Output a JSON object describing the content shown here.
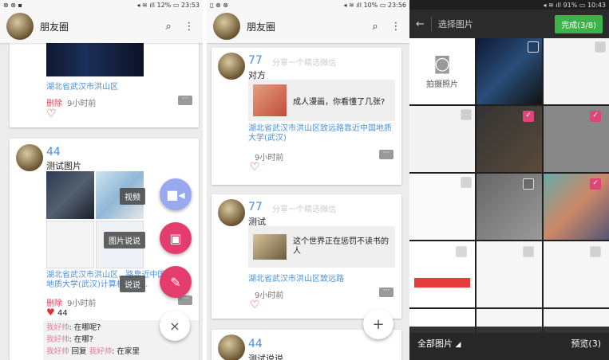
{
  "screen1": {
    "status_time": "23:53",
    "status_battery": "12%",
    "title": "朋友圈",
    "post1": {
      "location": "湖北省武汉市洪山区",
      "delete": "删除",
      "time": "9小时前"
    },
    "post2": {
      "num": "44",
      "text": "测试图片",
      "location": "湖北省武汉市洪山区...路靠近中国地质大学(武汉)计算机实验...",
      "delete": "删除",
      "time": "9小时前",
      "likes": "44",
      "comments": [
        {
          "user": "我好帅",
          "sep": ": ",
          "text": "在哪呢?"
        },
        {
          "user": "我好帅",
          "sep": ": ",
          "text": "在哪?"
        },
        {
          "user": "我好帅",
          "mid": " 回复 ",
          "user2": "我好帅",
          "sep": ": ",
          "text": "在家里"
        }
      ]
    },
    "fab_labels": {
      "video": "视频",
      "photo_text": "图片说说",
      "text": "说说"
    },
    "fab_close": "×"
  },
  "screen2": {
    "status_time": "23:56",
    "status_battery": "10%",
    "title": "朋友圈",
    "post1": {
      "num": "77",
      "share_hint": "分享一个精选微信",
      "text": "对方",
      "share_title": "成人漫画，你看懂了几张?",
      "location": "湖北省武汉市洪山区致远路靠近中国地质大学(武汉)",
      "time": "9小时前"
    },
    "post2": {
      "num": "77",
      "share_hint": "分享一个精选微信",
      "text": "测试",
      "share_title": "这个世界正在惩罚不读书的人",
      "location": "湖北省武汉市洪山区致远路",
      "time": "9小时前"
    },
    "post3": {
      "num": "44",
      "text": "测试说说"
    },
    "fab_add": "+"
  },
  "screen3": {
    "status_time": "10:43",
    "status_battery": "91%",
    "title": "选择图片",
    "done": "完成(3/8)",
    "camera_label": "拍摄照片",
    "all_photos": "全部图片",
    "preview": "预览(3)",
    "colors": {
      "done_bg": "#3cb34a"
    }
  }
}
